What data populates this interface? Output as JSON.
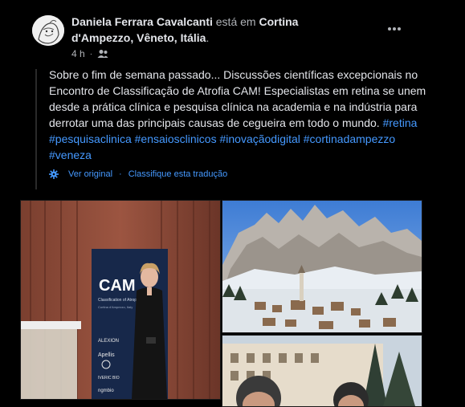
{
  "post": {
    "author": "Daniela Ferrara Cavalcanti",
    "connector": "está em",
    "location_part1": "Cortina",
    "location_part2": "d'Ampezzo, Vêneto, Itália",
    "location_suffix": ".",
    "time": "4 h",
    "audience_icon": "friends-icon",
    "text_main": "Sobre o fim de semana passado... Discussões científicas excepcionais no Encontro de Classificação de Atrofia CAM! Especialistas em retina se unem desde a prática clínica e pesquisa clínica na academia e na indústria para derrotar uma das principais causas de cegueira em todo o mundo.",
    "hashtags": [
      "#retina",
      "#pesquisaclinica",
      "#ensaiosclinicos",
      "#inovaçãodigital",
      "#cortinadampezzo",
      "#veneza"
    ],
    "see_original": "Ver original",
    "separator": "·",
    "rate_translation": "Classifique esta tradução"
  },
  "photos": {
    "stage": {
      "banner_title": "CAM",
      "banner_sub": "Classification of Atrophy",
      "banner_place": "Cortina d'Ampezzo, Italy",
      "sponsors": [
        "ALEXION",
        "Apellis",
        "IVERIC BIO",
        "ngmbio"
      ]
    },
    "mountain": {},
    "selfie": {}
  },
  "colors": {
    "background": "#000000",
    "link": "#4599ff",
    "muted": "#b0b3b8",
    "text": "#e4e6eb"
  }
}
